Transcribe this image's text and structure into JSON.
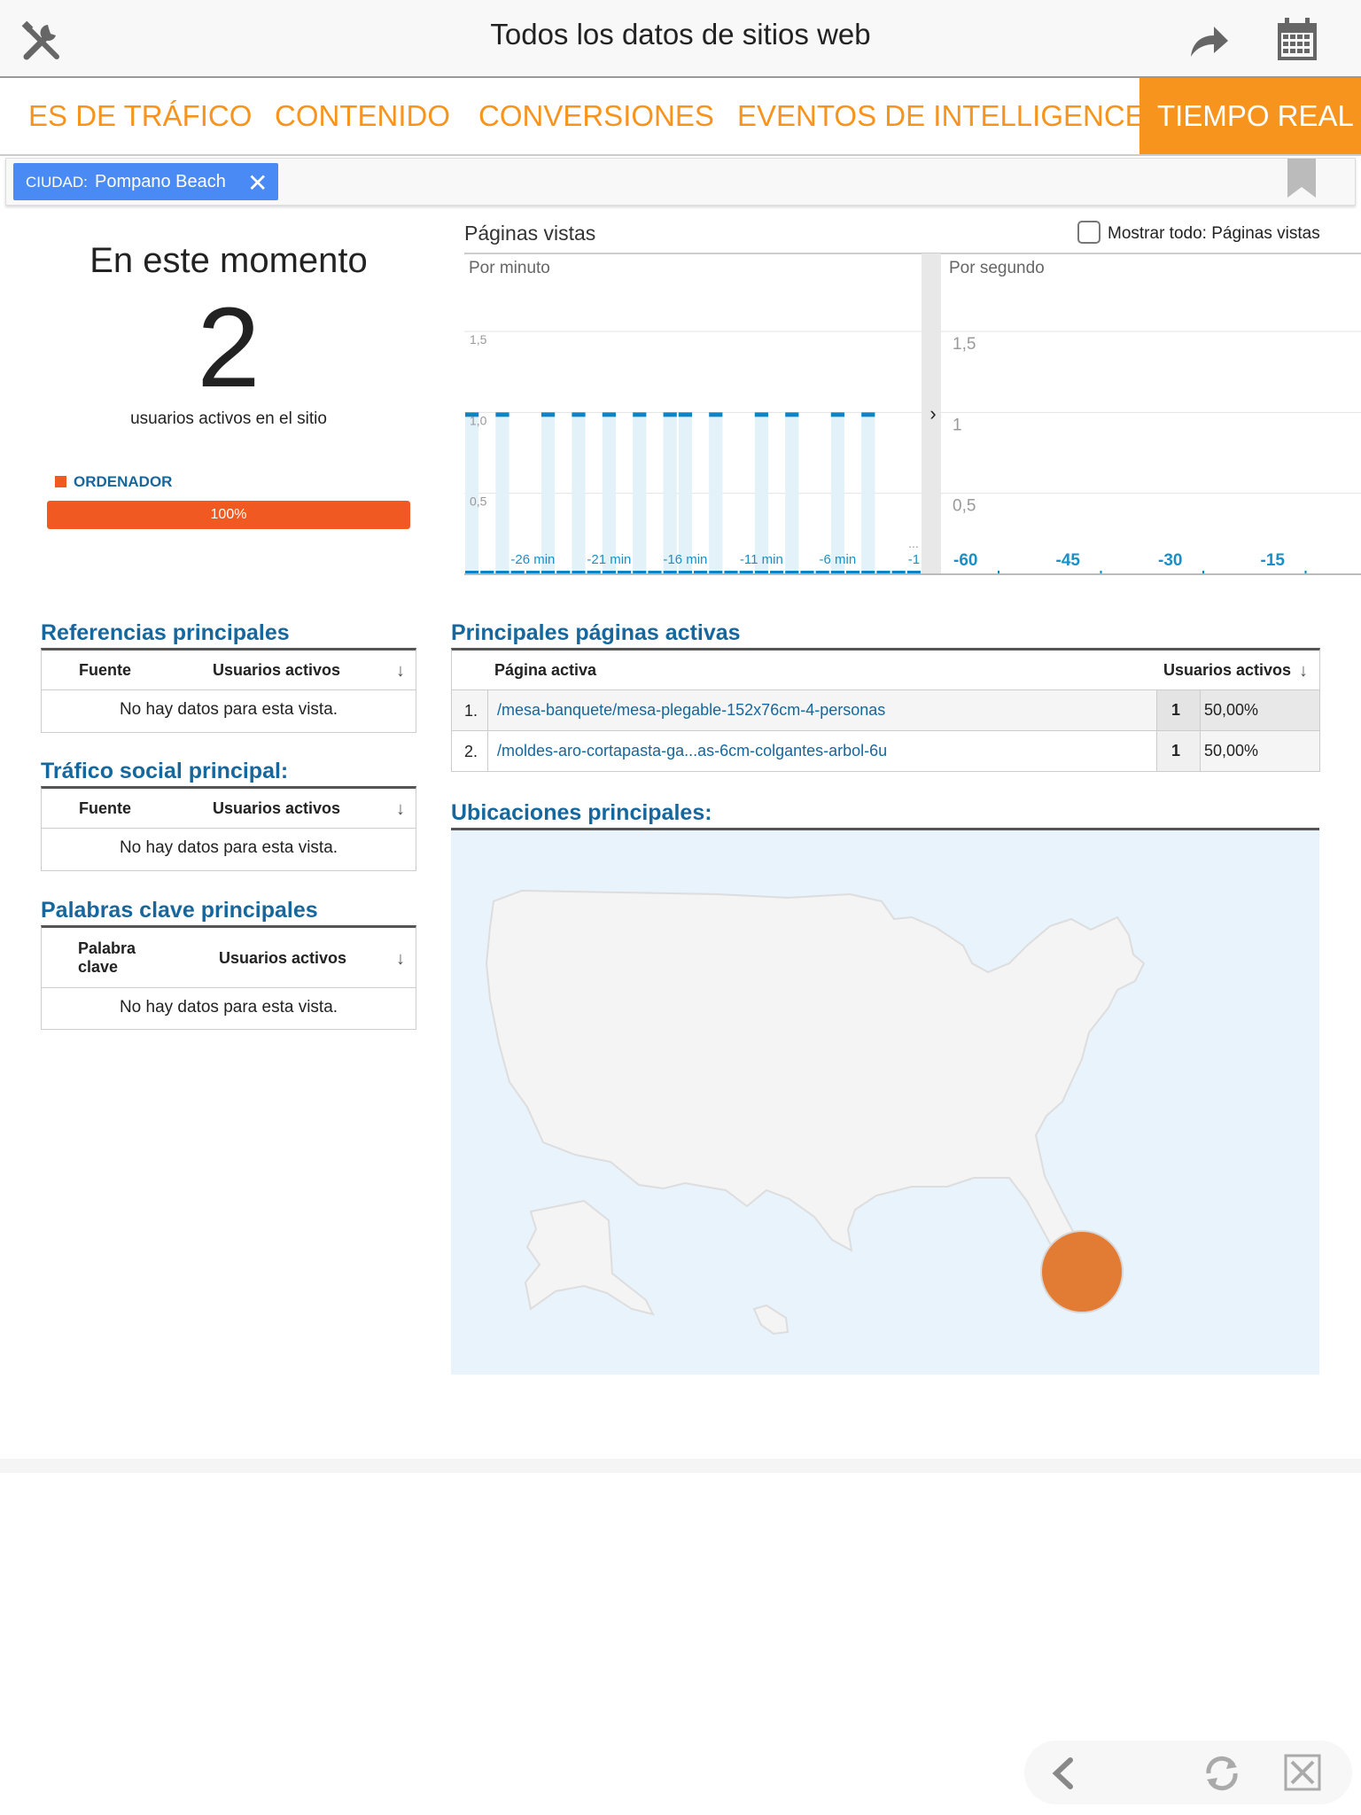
{
  "header": {
    "title": "Todos los datos de sitios web",
    "left_icon": "tools-icon",
    "share_icon": "share-arrow-icon",
    "calendar_icon": "calendar-icon"
  },
  "tabs": [
    {
      "label": "ES DE TRÁFICO",
      "active": false
    },
    {
      "label": "CONTENIDO",
      "active": false
    },
    {
      "label": "CONVERSIONES",
      "active": false
    },
    {
      "label": "EVENTOS DE INTELLIGENCE",
      "active": false
    },
    {
      "label": "TIEMPO REAL",
      "active": true
    }
  ],
  "filter": {
    "key": "CIUDAD:",
    "value": "Pompano Beach",
    "remove": "✕"
  },
  "summary": {
    "heading": "En este momento",
    "count": "2",
    "caption": "usuarios activos en el sitio",
    "device_label": "ORDENADOR",
    "device_percent": "100%",
    "device_fraction": 1.0
  },
  "pageviews": {
    "title": "Páginas vistas",
    "show_all_label": "Mostrar todo: Páginas vistas",
    "show_all_checked": false,
    "per_minute_label": "Por minuto",
    "per_second_label": "Por segundo",
    "expand_glyph": "›",
    "ellipsis": "..."
  },
  "chart_data": [
    {
      "type": "bar",
      "title": "Por minuto",
      "ylim": [
        0,
        1.5
      ],
      "y_ticks": [
        "1,5",
        "1,0",
        "0,5"
      ],
      "x_ticks": [
        "-26 min",
        "-21 min",
        "-16 min",
        "-11 min",
        "-6 min",
        "-1"
      ],
      "x": [
        -30,
        -29,
        -28,
        -27,
        -26,
        -25,
        -24,
        -23,
        -22,
        -21,
        -20,
        -19,
        -18,
        -17,
        -16,
        -15,
        -14,
        -13,
        -12,
        -11,
        -10,
        -9,
        -8,
        -7,
        -6,
        -5,
        -4,
        -3,
        -2,
        -1
      ],
      "values": [
        1,
        0,
        1,
        0,
        0,
        1,
        0,
        1,
        0,
        1,
        0,
        1,
        0,
        1,
        1,
        0,
        1,
        0,
        0,
        1,
        0,
        1,
        0,
        0,
        1,
        0,
        1,
        0,
        0,
        0
      ]
    },
    {
      "type": "bar",
      "title": "Por segundo",
      "ylim": [
        0,
        1.5
      ],
      "y_ticks": [
        "1,5",
        "1",
        "0,5"
      ],
      "x_ticks": [
        "-60",
        "-45",
        "-30",
        "-15"
      ],
      "values": []
    }
  ],
  "referrals": {
    "title": "Referencias principales",
    "col1": "Fuente",
    "col2": "Usuarios activos",
    "empty": "No hay datos para esta vista."
  },
  "social": {
    "title": "Tráfico social principal:",
    "col1": "Fuente",
    "col2": "Usuarios activos",
    "empty": "No hay datos para esta vista."
  },
  "keywords": {
    "title": "Palabras clave principales",
    "col1a": "Palabra",
    "col1b": "clave",
    "col2": "Usuarios activos",
    "empty": "No hay datos para esta vista."
  },
  "active_pages": {
    "title": "Principales páginas activas",
    "col1": "Página activa",
    "col2": "Usuarios activos",
    "rows": [
      {
        "n": "1.",
        "page": "/mesa-banquete/mesa-plegable-152x76cm-4-personas",
        "users": "1",
        "pct": "50,00%"
      },
      {
        "n": "2.",
        "page": "/moldes-aro-cortapasta-ga...as-6cm-colgantes-arbol-6u",
        "users": "1",
        "pct": "50,00%"
      }
    ]
  },
  "locations": {
    "title": "Ubicaciones principales:",
    "marker_color": "#e27b34",
    "water_color": "#e8f3fc",
    "land_color": "#f4f4f4"
  },
  "colors": {
    "accent": "#f7941d",
    "link": "#15679d",
    "device_bar": "#f05a22",
    "chip": "#4a8af4",
    "bar": "#0b85c4"
  },
  "footer_icons": [
    "back-chevron-icon",
    "refresh-icon",
    "fullscreen-icon"
  ]
}
